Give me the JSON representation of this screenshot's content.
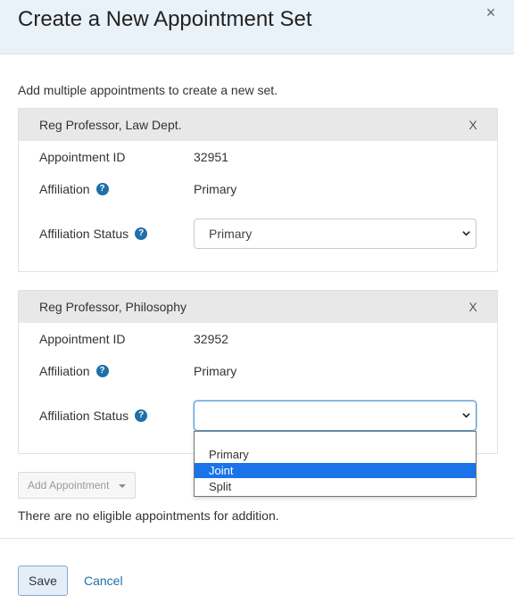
{
  "modal": {
    "title": "Create a New Appointment Set",
    "close_symbol": "×",
    "intro": "Add multiple appointments to create a new set."
  },
  "cards": [
    {
      "title": "Reg Professor, Law Dept.",
      "remove_symbol": "X",
      "appointment_id_label": "Appointment ID",
      "appointment_id": "32951",
      "affiliation_label": "Affiliation",
      "affiliation": "Primary",
      "affiliation_status_label": "Affiliation Status",
      "affiliation_status": "Primary"
    },
    {
      "title": "Reg Professor, Philosophy",
      "remove_symbol": "X",
      "appointment_id_label": "Appointment ID",
      "appointment_id": "32952",
      "affiliation_label": "Affiliation",
      "affiliation": "Primary",
      "affiliation_status_label": "Affiliation Status",
      "affiliation_status": ""
    }
  ],
  "help_symbol": "?",
  "dropdown": {
    "options": [
      "",
      "Primary",
      "Joint",
      "Split"
    ],
    "highlighted": "Joint"
  },
  "add_appointment": {
    "label": "Add Appointment",
    "disabled": true
  },
  "no_eligible_text": "There are no eligible appointments for addition.",
  "footer": {
    "save_label": "Save",
    "cancel_label": "Cancel"
  },
  "colors": {
    "header_bg": "#e9f1f9",
    "card_header_bg": "#e8e8e8",
    "help_icon": "#1f6fa8",
    "link": "#1f6fa8",
    "selected_option": "#1a73e8",
    "focus_border": "#5b9dd9"
  }
}
